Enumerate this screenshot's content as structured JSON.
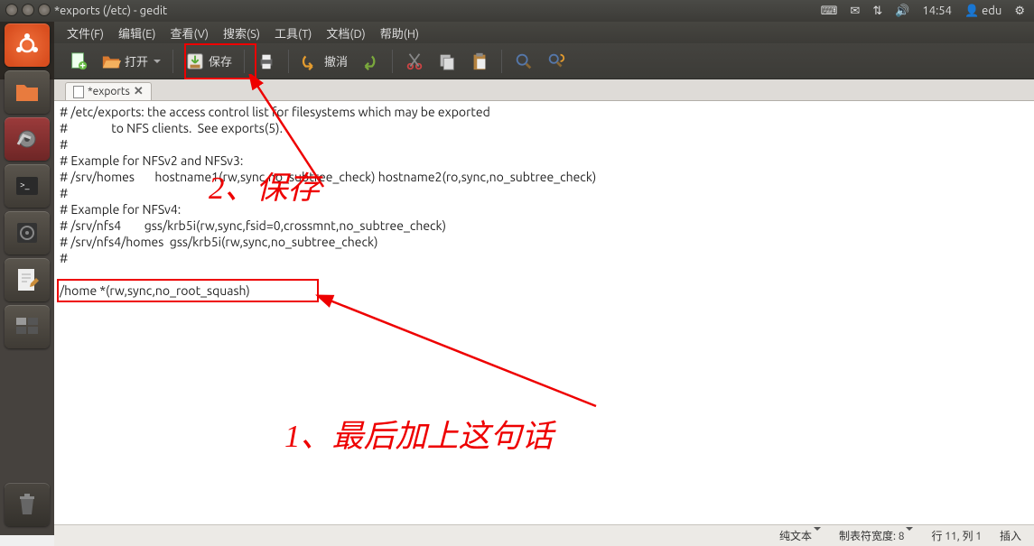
{
  "panel": {
    "title": "*exports (/etc) - gedit",
    "time": "14:54",
    "user": "edu"
  },
  "menu": {
    "file": "文件(F)",
    "edit": "编辑(E)",
    "view": "查看(V)",
    "search": "搜索(S)",
    "tools": "工具(T)",
    "docs": "文档(D)",
    "help": "帮助(H)"
  },
  "toolbar": {
    "open": "打开",
    "save": "保存",
    "undo": "撤消"
  },
  "tab": {
    "name": "*exports"
  },
  "editor": {
    "lines": [
      "# /etc/exports: the access control list for filesystems which may be exported",
      "#               to NFS clients.  See exports(5).",
      "#",
      "# Example for NFSv2 and NFSv3:",
      "# /srv/homes       hostname1(rw,sync,no_subtree_check) hostname2(ro,sync,no_subtree_check)",
      "#",
      "# Example for NFSv4:",
      "# /srv/nfs4        gss/krb5i(rw,sync,fsid=0,crossmnt,no_subtree_check)",
      "# /srv/nfs4/homes  gss/krb5i(rw,sync,no_subtree_check)",
      "#",
      "",
      "/home *(rw,sync,no_root_squash)"
    ]
  },
  "status": {
    "lang": "纯文本",
    "tabw": "制表符宽度: 8",
    "pos": "行 11, 列 1",
    "ins": "插入"
  },
  "annotations": {
    "a1": "1、最后加上这句话",
    "a2": "2、保存"
  }
}
